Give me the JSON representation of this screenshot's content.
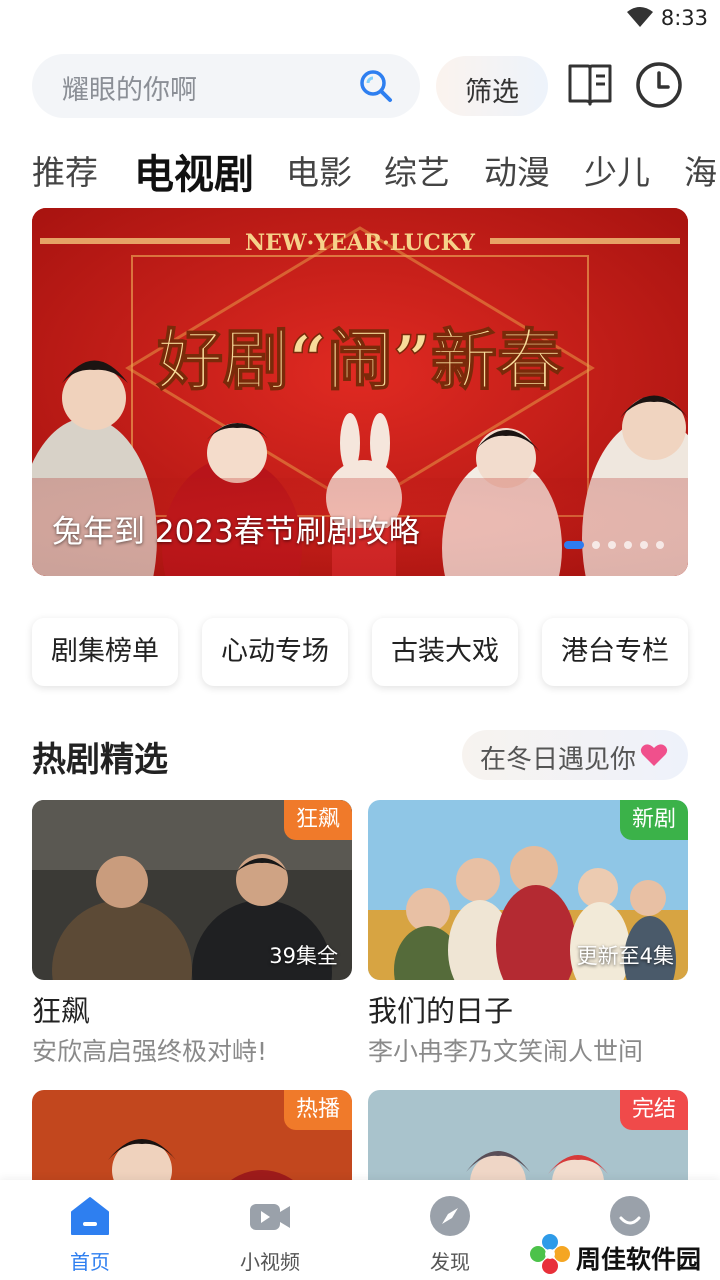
{
  "status_bar": {
    "time": "8:33",
    "wifi_icon": "wifi-icon"
  },
  "header": {
    "search": {
      "placeholder": "耀眼的你啊",
      "icon": "search-icon"
    },
    "filter_label": "筛选",
    "icons": [
      "book-icon",
      "history-icon"
    ]
  },
  "tabs": [
    {
      "label": "推荐",
      "active": false
    },
    {
      "label": "电视剧",
      "active": true
    },
    {
      "label": "电影",
      "active": false
    },
    {
      "label": "综艺",
      "active": false
    },
    {
      "label": "动漫",
      "active": false
    },
    {
      "label": "少儿",
      "active": false
    },
    {
      "label": "海",
      "active": false
    }
  ],
  "banner": {
    "caption": "兔年到 2023春节刷剧攻略",
    "headline": "好剧“闹”新春",
    "tagline": "NEW·YEAR·LUCKY",
    "dot_count": 6,
    "active_dot": 0
  },
  "quick_links": [
    "剧集榜单",
    "心动专场",
    "古装大戏",
    "港台专栏"
  ],
  "section": {
    "title": "热剧精选",
    "tag": "在冬日遇见你",
    "tag_icon": "heart-icon"
  },
  "cards": [
    {
      "title": "狂飙",
      "desc": "安欣高启强终极对峙!",
      "badge": "狂飙",
      "badge_color": "#f07a2a",
      "episodes": "39集全"
    },
    {
      "title": "我们的日子",
      "desc": "李小冉李乃文笑闹人世间",
      "badge": "新剧",
      "badge_color": "#3bb249",
      "episodes": "更新至4集"
    },
    {
      "title": "",
      "desc": "",
      "badge": "热播",
      "badge_color": "#f07a2a",
      "episodes": ""
    },
    {
      "title": "",
      "desc": "",
      "badge": "完结",
      "badge_color": "#f04a4a",
      "episodes": ""
    }
  ],
  "bottom_nav": [
    {
      "label": "首页",
      "icon": "home-icon",
      "active": true
    },
    {
      "label": "小视频",
      "icon": "video-camera-icon",
      "active": false
    },
    {
      "label": "发现",
      "icon": "compass-icon",
      "active": false
    },
    {
      "label": "",
      "icon": "profile-icon",
      "active": false
    }
  ],
  "watermark": {
    "text": "周佳软件园"
  },
  "colors": {
    "accent": "#2e7ff0",
    "banner_red": "#c41a1a",
    "gold": "#f6d28a"
  }
}
